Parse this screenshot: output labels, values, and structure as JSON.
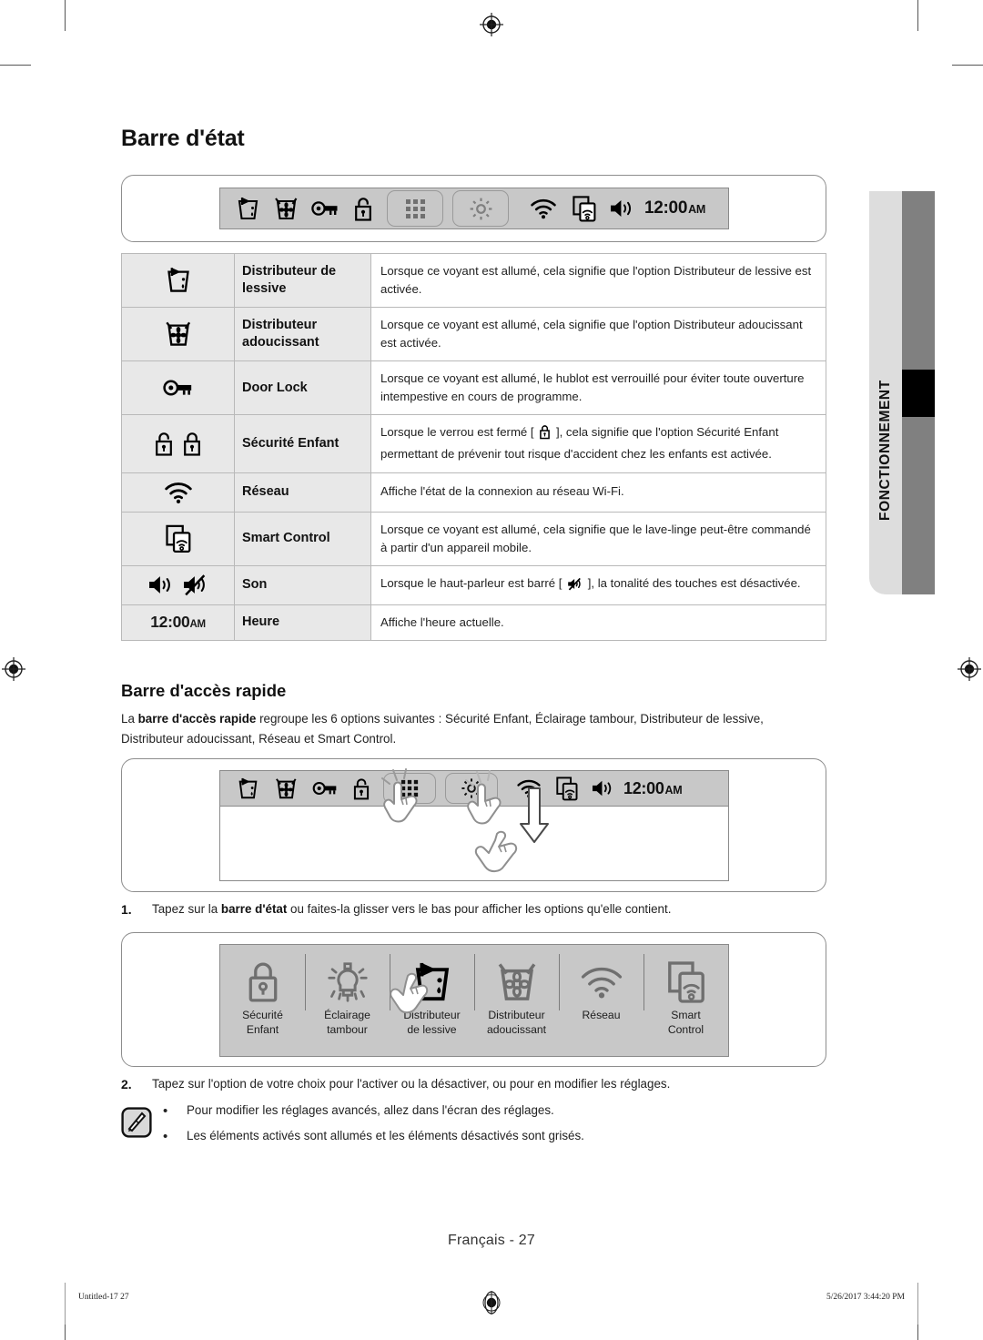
{
  "document": {
    "page_title": "Barre d'état",
    "side_tab_label": "FONCTIONNEMENT",
    "page_footer": "Français - 27",
    "print_footer_left": "Untitled-17   27",
    "print_footer_right": "5/26/2017   3:44:20 PM"
  },
  "status_bar": {
    "clock_time": "12:00",
    "clock_ampm": "AM",
    "icons": [
      "detergent-dispenser-icon",
      "softener-dispenser-icon",
      "door-lock-icon",
      "child-lock-open-icon",
      "quick-access-grid-icon",
      "settings-gear-icon",
      "network-wifi-icon",
      "smart-control-icon",
      "sound-on-icon"
    ]
  },
  "table": {
    "rows": [
      {
        "icon": "detergent-dispenser-icon",
        "name": "Distributeur de lessive",
        "description": "Lorsque ce voyant est allumé, cela signifie que l'option Distributeur de lessive est activée."
      },
      {
        "icon": "softener-dispenser-icon",
        "name": "Distributeur adoucissant",
        "description": "Lorsque ce voyant est allumé, cela signifie que l'option Distributeur adoucissant est activée."
      },
      {
        "icon": "door-lock-icon",
        "name": "Door Lock",
        "description": "Lorsque ce voyant est allumé, le hublot est verrouillé pour éviter toute ouverture intempestive en cours de programme."
      },
      {
        "icon": "child-lock-icons",
        "name": "Sécurité Enfant",
        "description_before": "Lorsque le verrou est fermé [",
        "description_after": "], cela signifie que l'option Sécurité Enfant permettant de prévenir tout risque d'accident chez les enfants est activée."
      },
      {
        "icon": "network-wifi-icon",
        "name": "Réseau",
        "description": "Affiche l'état de la connexion au réseau Wi-Fi."
      },
      {
        "icon": "smart-control-icon",
        "name": "Smart Control",
        "description": "Lorsque ce voyant est allumé, cela signifie que le lave-linge peut-être commandé à partir d'un appareil mobile."
      },
      {
        "icon": "sound-icons",
        "name": "Son",
        "description_before": "Lorsque le haut-parleur est barré [",
        "description_after": "], la tonalité des touches est désactivée."
      },
      {
        "icon": "clock-time",
        "name": "Heure",
        "description": "Affiche l'heure actuelle."
      }
    ]
  },
  "quick_access": {
    "subheading": "Barre d'accès rapide",
    "intro_part1": "La ",
    "intro_bold": "barre d'accès rapide",
    "intro_part2": " regroupe les 6 options suivantes : Sécurité Enfant, Éclairage tambour, Distributeur de lessive, Distributeur adoucissant, Réseau et Smart Control.",
    "options": [
      {
        "icon": "child-lock-icon",
        "label_line1": "Sécurité",
        "label_line2": "Enfant"
      },
      {
        "icon": "drum-light-icon",
        "label_line1": "Éclairage",
        "label_line2": "tambour"
      },
      {
        "icon": "detergent-dispenser-icon",
        "label_line1": "Distributeur",
        "label_line2": "de lessive"
      },
      {
        "icon": "softener-dispenser-icon",
        "label_line1": "Distributeur",
        "label_line2": "adoucissant"
      },
      {
        "icon": "network-wifi-icon",
        "label_line1": "Réseau",
        "label_line2": ""
      },
      {
        "icon": "smart-control-icon",
        "label_line1": "Smart",
        "label_line2": "Control"
      }
    ]
  },
  "steps": [
    {
      "number": "1.",
      "text_part1": "Tapez sur la ",
      "text_bold": "barre d'état",
      "text_part2": " ou faites-la glisser vers le bas pour afficher les options qu'elle contient."
    },
    {
      "number": "2.",
      "text_part1": "Tapez sur l'option de votre choix pour l'activer ou la désactiver, ou pour en modifier les réglages.",
      "text_bold": "",
      "text_part2": ""
    }
  ],
  "note": {
    "icon": "note-pen-icon",
    "bullets": [
      "Pour modifier les réglages avancés, allez dans l'écran des réglages.",
      "Les éléments activés sont allumés et les éléments désactivés sont grisés."
    ]
  },
  "colors": {
    "status_bar_fill": "#c8c8c8",
    "table_header_fill": "#e8e8e8",
    "side_tab_light": "#dddddd",
    "side_tab_dark": "#808080",
    "side_tab_marker": "#000000"
  }
}
